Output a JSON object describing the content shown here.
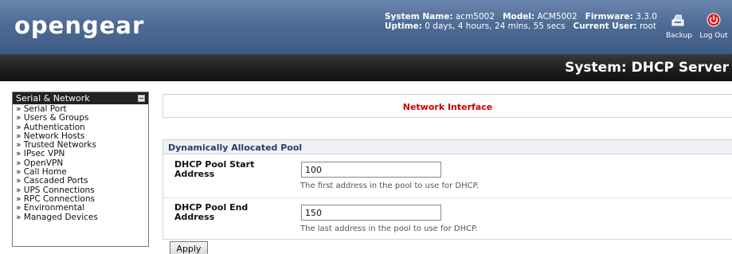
{
  "header": {
    "logo_text": "opengear",
    "system_name_label": "System Name:",
    "system_name_value": "acm5002",
    "model_label": "Model:",
    "model_value": "ACM5002",
    "firmware_label": "Firmware:",
    "firmware_value": "3.3.0",
    "uptime_label": "Uptime:",
    "uptime_value": "0 days, 4 hours, 24 mins, 55 secs",
    "current_user_label": "Current User:",
    "current_user_value": "root",
    "backup_label": "Backup",
    "logout_label": "Log Out",
    "backup_icon": "backup-icon",
    "logout_icon": "power-icon"
  },
  "title_bar": {
    "title": "System: DHCP Server"
  },
  "sidebar": {
    "header": "Serial & Network",
    "items": [
      "» Serial Port",
      "» Users & Groups",
      "» Authentication",
      "» Network Hosts",
      "» Trusted Networks",
      "» IPsec VPN",
      "» OpenVPN",
      "» Call Home",
      "» Cascaded Ports",
      "» UPS Connections",
      "» RPC Connections",
      "» Environmental",
      "» Managed Devices"
    ]
  },
  "main": {
    "network_interface_title": "Network Interface",
    "pool_header": "Dynamically Allocated Pool",
    "start_label": "DHCP Pool Start Address",
    "start_value": "100",
    "start_help": "The first address in the pool to use for DHCP.",
    "end_label": "DHCP Pool End Address",
    "end_value": "150",
    "end_help": "The last address in the pool to use for DHCP.",
    "apply_label": "Apply"
  },
  "colors": {
    "header_blue": "#4e6b95",
    "title_bar": "#1e1e1e",
    "network_interface_red": "#cc0000",
    "pool_header_text": "#2a3d66"
  }
}
